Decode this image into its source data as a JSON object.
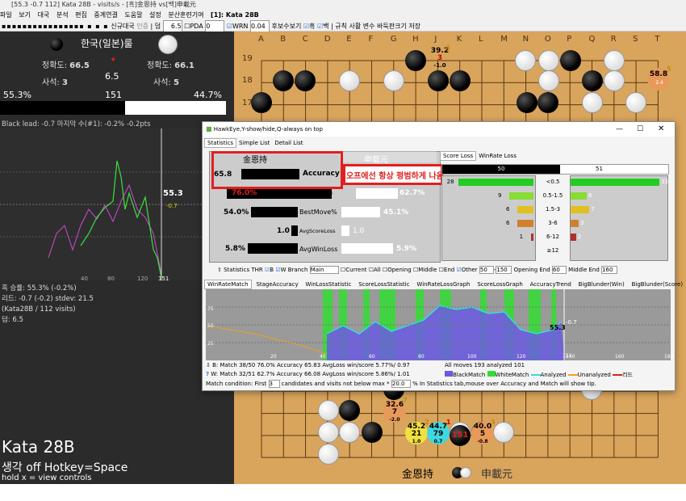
{
  "window": {
    "title": "[55.3 -0.7 112] Kata 28B - visits/s - [흑]金恩持 vs[백]申載元"
  },
  "menu": [
    "파일",
    "보기",
    "대국",
    "분석",
    "편집",
    "중계연결",
    "도움말",
    "설정",
    "분산훈련기여"
  ],
  "toolbar": {
    "engine_label": "[1]: Kata 28B",
    "new_game": "신규대국",
    "auth": "인증",
    "komi_label": "덤",
    "komi_value": "6.5",
    "pda": "PDA",
    "pda_value": "0",
    "wrn": "WRN",
    "wrn_value": "0.04",
    "show_next": "후보수보기",
    "black": "흑",
    "white": "백",
    "extras": "규칙 사활 변수 바둑판크기 저장"
  },
  "left_panel": {
    "rule": "한국(일본)룰",
    "black_acc_label": "정확도:",
    "black_acc": "66.5",
    "white_acc_label": "정확도:",
    "white_acc": "66.1",
    "black_eye_label": "사석:",
    "black_eye": "3",
    "white_eye_label": "사석:",
    "white_eye": "5",
    "komi": "6.5",
    "black_winrate": "55.3%",
    "move_no": "151",
    "white_winrate": "44.7%",
    "black_lead": "Black lead: -0.7 마지막 수(#1): -0.2% -0.2pts",
    "graph_val1": "55.3",
    "graph_val2": "-0.7",
    "graph_ticks": [
      "40",
      "80",
      "120",
      "151",
      "80"
    ],
    "info_lines": [
      "흑 승률: 55.3% (-0.2%)",
      "리드: -0.7 (-0.2) stdev: 21.5",
      "(Kata28B / 112 visits)",
      "덤: 6.5"
    ],
    "engine_name": "Kata 28B",
    "hotkey": "생각 off  Hotkey=Space",
    "hint": "hold x = view controls"
  },
  "board": {
    "cols": [
      "A",
      "B",
      "C",
      "D",
      "E",
      "F",
      "G",
      "H",
      "J",
      "K",
      "L",
      "M",
      "N",
      "O",
      "P",
      "Q",
      "R",
      "S",
      "T"
    ],
    "rows": [
      "19",
      "18",
      "17"
    ],
    "cand1_win": "39.2",
    "cand1_vis": "3",
    "cand1_lead": "-1.0",
    "cand1_rank": "4",
    "cand2_win": "58.8",
    "cand2_rank": "5",
    "cand2_lead": "2.4",
    "bottom_cands": [
      {
        "win": "32.6",
        "vis": "7",
        "lead": "-2.0",
        "rank": "7"
      },
      {
        "win": "45.2",
        "vis": "21",
        "lead": "1.0",
        "rank": "2"
      },
      {
        "win": "44.7",
        "vis": "79",
        "lead": "0.7",
        "rank": "1"
      },
      {
        "win": "40.0",
        "vis": "5",
        "lead": "-0.8",
        "rank": "3"
      }
    ],
    "last_move": "151",
    "black_player": "金恩持",
    "white_player": "申載元"
  },
  "hawk": {
    "title": "HawkEye,Y-show/hide,Q-always on top",
    "tabs": [
      "Statistics",
      "Simple List",
      "Detail List"
    ],
    "black_player": "金恩持",
    "white_player": "申载元",
    "rows": [
      {
        "name": "Accuracy",
        "black": "65.8",
        "white": ""
      },
      {
        "name": "Match",
        "black": "76.0%",
        "white": "62.7%"
      },
      {
        "name": "BestMove%",
        "black": "54.0%",
        "white": "45.1%"
      },
      {
        "name": "AvgScoreLoss",
        "black": "1.0",
        "white": "1.0"
      },
      {
        "name": "AvgWinLoss",
        "black": "5.8%",
        "white": "5.9%"
      }
    ],
    "annotation": "오프에선 항상 평범하게 나옴",
    "loss_tabs": [
      "Score Loss",
      "WinRate Loss"
    ],
    "loss_black_total": "50",
    "loss_white_total": "51",
    "loss_rows": [
      {
        "range": "<0.5",
        "b": "28",
        "w": "33"
      },
      {
        "range": "0.5-1.5",
        "b": "9",
        "w": "6"
      },
      {
        "range": "1.5-3",
        "b": "6",
        "w": "7"
      },
      {
        "range": "3-6",
        "b": "6",
        "w": "3"
      },
      {
        "range": "6-12",
        "b": "1",
        "w": "2"
      },
      {
        "range": "≥12",
        "b": "",
        "w": ""
      }
    ],
    "filter_line": {
      "stat_thr": "Statistics THR",
      "b": "B",
      "w": "W",
      "branch": "Branch",
      "branch_val": "Main",
      "current": "Current",
      "all": "All",
      "opening": "Opening",
      "middle": "Middle",
      "end": "End",
      "other": "Other",
      "from": "50",
      "to": "150",
      "opening_end_label": "Opening End",
      "opening_end": "60",
      "middle_end_label": "Middle End",
      "middle_end": "160"
    },
    "graph_tabs": [
      "WinRateMatch",
      "StageAccuracy",
      "WinLossStatistic",
      "ScoreLossStatistic",
      "WinRateLossGraph",
      "ScoreLossGraph",
      "AccuracyTrend",
      "BigBlunder(Win)",
      "BigBlunder(Score)"
    ],
    "graph_y": [
      "75",
      "50",
      "25"
    ],
    "graph_x": [
      "20",
      "40",
      "60",
      "80",
      "100",
      "120",
      "140",
      "160",
      "180"
    ],
    "graph_last": "151",
    "graph_val": "55.3",
    "graph_val2": "-0.7",
    "b_line": "B: Match 38/50 76.0% Accuracy 65.83 AvgLoss win/score 5.77%/ 0.97",
    "w_line": "W: Match 32/51 62.7% Accuracy 66.08 AvgLoss win/score 5.86%/ 1.01",
    "all_moves": "All moves 193 analyzed 101",
    "legend": [
      "BlackMatch",
      "WhiteMatch",
      "Analyzed",
      "Unanalyzed",
      "리드"
    ],
    "match_condition": "Match condition: First",
    "match_first": "3",
    "match_mid": "candidates and visits not below max *",
    "match_pct": "20.0",
    "match_tail": "%   In Statistics tab,mouse over Accuracy and Match will show tip."
  },
  "colors": {
    "red": "#e02020",
    "green": "#33dd33",
    "purple": "#9a66ee",
    "cyan": "#33dddd",
    "orange": "#f0a020"
  }
}
